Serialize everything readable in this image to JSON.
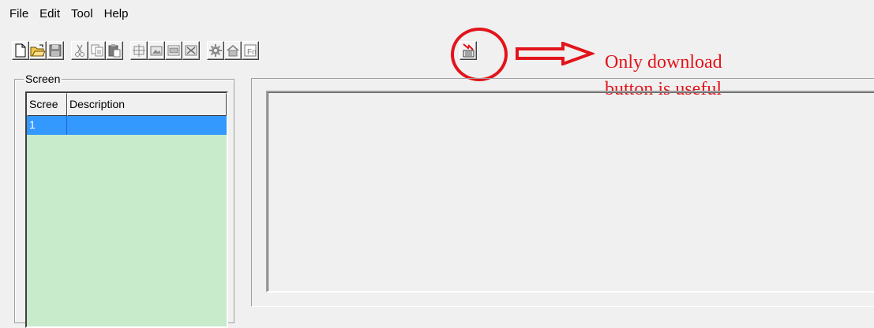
{
  "menu": [
    "File",
    "Edit",
    "Tool",
    "Help"
  ],
  "toolbar": {
    "buttons": [
      {
        "name": "new-file",
        "icon": "new-document-icon"
      },
      {
        "name": "open-file",
        "icon": "open-folder-icon"
      },
      {
        "name": "save-file",
        "icon": "save-disk-icon",
        "disabled": true
      },
      {
        "name": "cut",
        "icon": "scissors-icon",
        "disabled": true
      },
      {
        "name": "copy",
        "icon": "copy-icon",
        "disabled": true
      },
      {
        "name": "paste",
        "icon": "paste-icon",
        "disabled": true
      },
      {
        "name": "tool-1",
        "icon": "screen-frame-icon",
        "disabled": true
      },
      {
        "name": "tool-2",
        "icon": "image-edit-icon",
        "disabled": true
      },
      {
        "name": "tool-3",
        "icon": "window-icon",
        "disabled": true
      },
      {
        "name": "tool-4",
        "icon": "delete-image-icon",
        "disabled": true
      },
      {
        "name": "tool-5",
        "icon": "gear-icon",
        "disabled": true
      },
      {
        "name": "tool-6",
        "icon": "home-icon",
        "disabled": true
      },
      {
        "name": "tool-7",
        "icon": "function-icon",
        "disabled": true
      },
      {
        "name": "download",
        "icon": "download-to-device-icon"
      }
    ]
  },
  "annotation": {
    "text_line1": "Only download",
    "text_line2": "button is useful",
    "color": "#e3141b"
  },
  "screen_panel": {
    "label": "Screen",
    "columns": [
      "Scree",
      "Description"
    ],
    "rows": [
      {
        "screen": "1",
        "description": ""
      }
    ]
  },
  "colors": {
    "list_background": "#c8ebcb",
    "selection": "#3399ff",
    "window_background": "#f0f0f0"
  }
}
